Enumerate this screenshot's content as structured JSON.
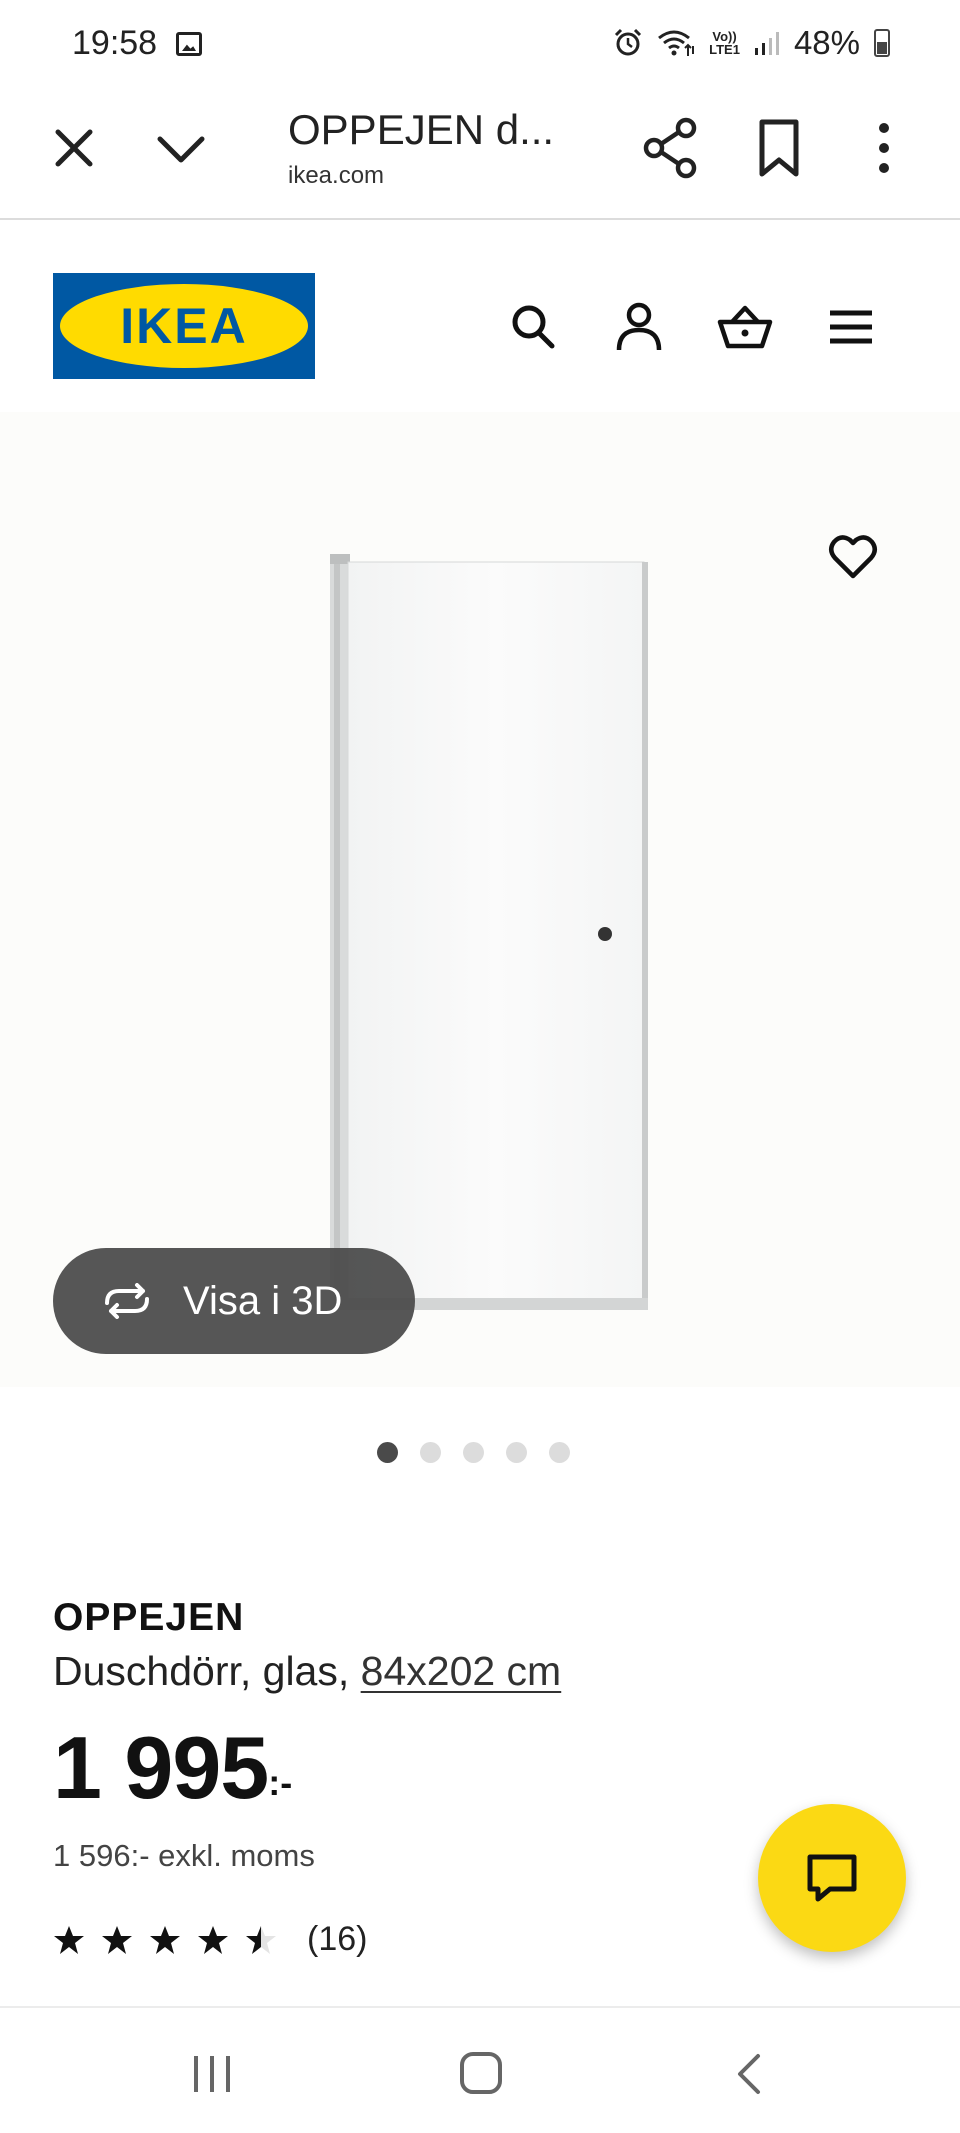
{
  "status_bar": {
    "time": "19:58",
    "volte_line1": "Vo))",
    "volte_line2": "LTE1",
    "battery": "48%",
    "icons": [
      "image-icon",
      "alarm-icon",
      "wifi-icon",
      "volte-icon",
      "signal-icon",
      "battery-icon"
    ]
  },
  "browser": {
    "page_title": "OPPEJEN d...",
    "url": "ikea.com",
    "icons": [
      "close-icon",
      "chevron-down-icon",
      "share-icon",
      "bookmark-icon",
      "more-vert-icon"
    ]
  },
  "header": {
    "logo_text": "IKEA",
    "brand_colors": {
      "blue": "#0058a3",
      "yellow": "#ffdb00"
    },
    "icons": [
      "search-icon",
      "profile-icon",
      "basket-icon",
      "menu-icon"
    ]
  },
  "gallery": {
    "view_3d_label": "Visa i 3D",
    "image_count": 5,
    "active_image_index": 0
  },
  "product": {
    "name": "OPPEJEN",
    "description": "Duschdörr, glas,",
    "size": "84x202 cm",
    "price": "1 995",
    "price_suffix": ":-",
    "price_excl_vat": "1 596:- exkl. moms",
    "rating": 4.5,
    "rating_max": 5,
    "review_count": "(16)"
  },
  "colors": {
    "chat_fab": "#fbd914",
    "view3d_bg": "#484848"
  },
  "nav": {
    "icons": [
      "recent-apps-icon",
      "home-icon",
      "back-icon"
    ]
  }
}
